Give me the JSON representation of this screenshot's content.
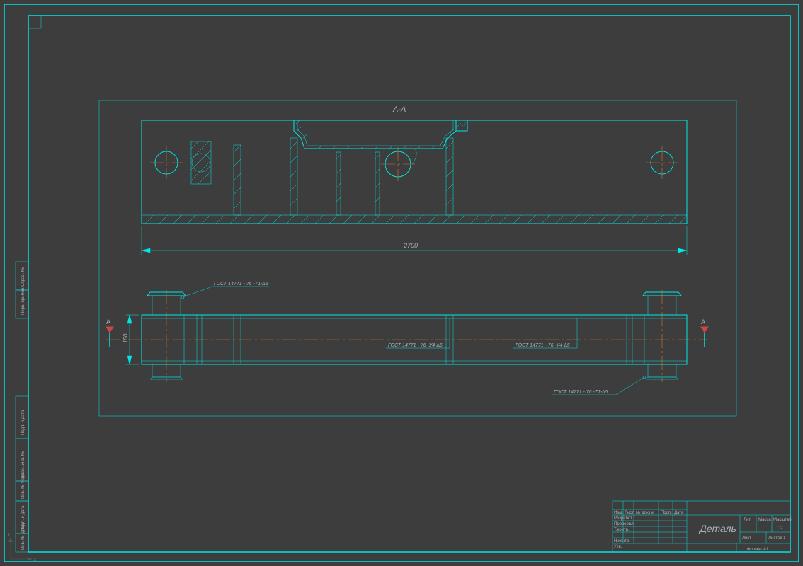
{
  "section_label": "А-А",
  "dim_width": "2700",
  "dim_height": "150",
  "weld1": "ГОСТ 14771 - 76 -Т1-∆5",
  "weld2": "ГОСТ 14771 - 76 -У4-∆5",
  "weld3": "ГОСТ 14771 - 76 -У4-∆5",
  "weld4": "ГОСТ 14771 - 76 -Т1-∆5",
  "title_main": "Деталь",
  "tb": {
    "r1": "Разработ.",
    "r2": "Проверил",
    "r3": "Т.контр.",
    "r4": "Н.контр.",
    "r5": "Утв.",
    "h1": "Изм.",
    "h2": "Лист",
    "h3": "№ докум.",
    "h4": "Подп.",
    "h5": "Дата",
    "c1": "Лит.",
    "c2": "Масса",
    "c3": "Масштаб",
    "scale": "1:2",
    "sheet": "Лист",
    "sheets": "Листов 1",
    "format": "Формат   A1"
  },
  "sidebar": {
    "s1": "Подп. и дата",
    "s2": "Инв. № подл.",
    "s3": "Взам. инв. №",
    "s4": "Подп. и дата",
    "s5": "Инв. № дубл.",
    "s6": "Справ. №",
    "s7": "Перв. примен."
  },
  "marker": "A"
}
